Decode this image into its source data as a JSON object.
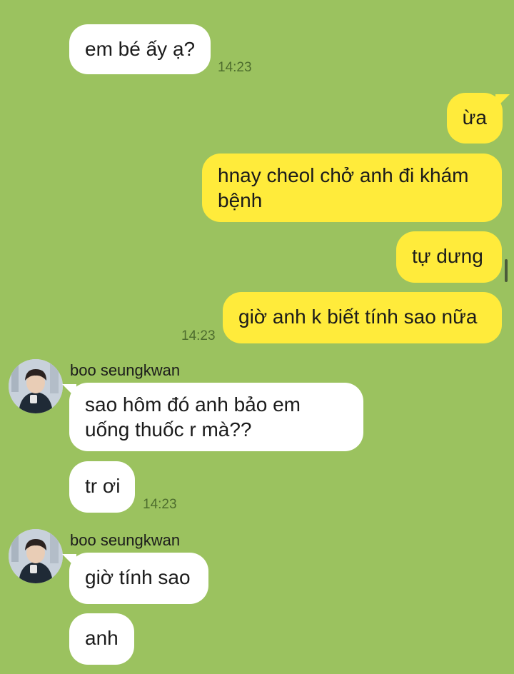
{
  "messages": [
    {
      "side": "in",
      "text": "em bé ấy ạ?",
      "time": "14:23"
    },
    {
      "side": "out",
      "text": "ừa"
    },
    {
      "side": "out",
      "text": "hnay cheol chở anh đi khám bệnh"
    },
    {
      "side": "out",
      "text": "tự dưng"
    },
    {
      "side": "out",
      "text": "giờ anh k biết tính sao nữa",
      "time": "14:23"
    },
    {
      "side": "in",
      "sender": "boo seungkwan",
      "text": "sao hôm đó anh bảo em uống thuốc r mà??"
    },
    {
      "side": "in",
      "text": "tr ơi",
      "time": "14:23"
    },
    {
      "side": "in",
      "sender": "boo seungkwan",
      "text": "giờ tính sao"
    },
    {
      "side": "in",
      "text": "anh"
    }
  ],
  "colors": {
    "background": "#9BC25F",
    "incoming_bubble": "#FFFFFF",
    "outgoing_bubble": "#FFEB3B"
  }
}
